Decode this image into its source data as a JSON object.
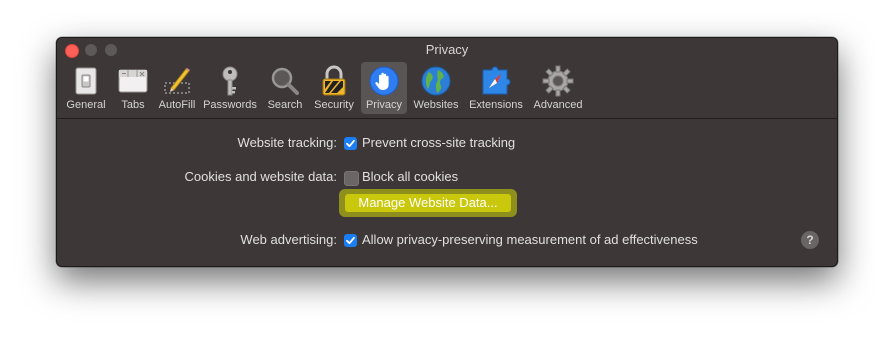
{
  "window": {
    "title": "Privacy"
  },
  "toolbar": {
    "items": [
      {
        "label": "General",
        "icon": "general-switch-icon"
      },
      {
        "label": "Tabs",
        "icon": "tabs-icon"
      },
      {
        "label": "AutoFill",
        "icon": "autofill-pencil-icon"
      },
      {
        "label": "Passwords",
        "icon": "key-icon"
      },
      {
        "label": "Search",
        "icon": "magnifier-icon"
      },
      {
        "label": "Security",
        "icon": "padlock-icon"
      },
      {
        "label": "Privacy",
        "icon": "hand-icon",
        "active": true
      },
      {
        "label": "Websites",
        "icon": "globe-icon"
      },
      {
        "label": "Extensions",
        "icon": "puzzle-compass-icon"
      },
      {
        "label": "Advanced",
        "icon": "gear-icon"
      }
    ]
  },
  "privacy": {
    "tracking_label": "Website tracking:",
    "tracking_option": "Prevent cross-site tracking",
    "tracking_checked": true,
    "cookies_label": "Cookies and website data:",
    "cookies_option": "Block all cookies",
    "cookies_checked": false,
    "manage_button": "Manage Website Data...",
    "advertising_label": "Web advertising:",
    "advertising_option": "Allow privacy-preserving measurement of ad effectiveness",
    "advertising_checked": true,
    "help_label": "?"
  },
  "colors": {
    "window_bg": "#3d3737",
    "accent_blue": "#1a7ef6",
    "highlight_yellow": "#c9c80d",
    "close_red": "#fe5f57"
  }
}
